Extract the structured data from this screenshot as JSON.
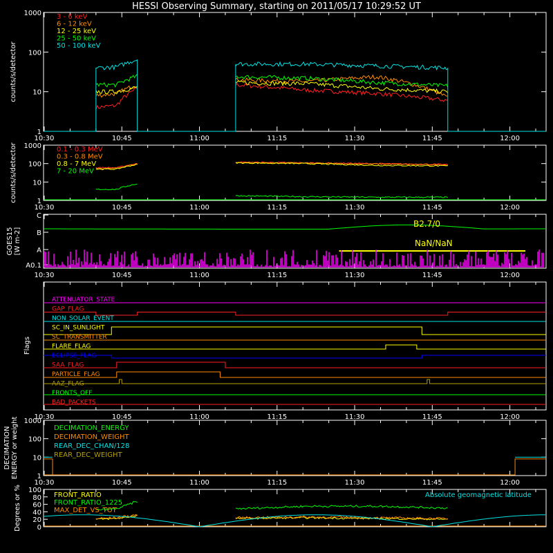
{
  "title": "HESSI Observing Summary, starting on 2011/05/17 10:29:52 UT",
  "time_ticks": [
    "10:30",
    "10:45",
    "11:00",
    "11:15",
    "11:30",
    "11:45",
    "12:00"
  ],
  "colors": {
    "red": "#ff2020",
    "orange": "#ff8c00",
    "yellow": "#ffff00",
    "green": "#00ff00",
    "cyan": "#00e5e5",
    "magenta": "#ff00ff",
    "blue": "#0000ff",
    "olive": "#b8a000",
    "axis": "#ffffff"
  },
  "panels": {
    "p1": {
      "ylabel": "counts/s/detector",
      "yticks": [
        "1",
        "10",
        "100",
        "1000"
      ],
      "legend": [
        "3 - 6 keV",
        "6 - 12 keV",
        "12 - 25 keV",
        "25 - 50 keV",
        "50 - 100 keV"
      ]
    },
    "p2": {
      "ylabel": "counts/s/detector",
      "yticks": [
        "1",
        "10",
        "100",
        "1000"
      ],
      "legend": [
        "0.1 - 0.3 MeV",
        "0.3 - 0.8 MeV",
        "0.8 - 7 MeV",
        "7 - 20 MeV"
      ]
    },
    "p3": {
      "ylabel": "GOES15",
      "ylabel_unit": "[W m-2]",
      "yticks": [
        "A0.1",
        "A",
        "B",
        "C"
      ],
      "annotations": [
        "B2.7/0",
        "NaN/NaN"
      ]
    },
    "p4": {
      "ylabel": "Flags",
      "flags": [
        "ATTENUATOR_STATE",
        "GAP_FLAG",
        "NON_SOLAR_EVENT",
        "SC_IN_SUNLIGHT",
        "SC_TRANSMITTER",
        "FLARE_FLAG",
        "ECLIPSE_FLAG",
        "SAA_FLAG",
        "PARTICLE_FLAG",
        "AAZ_FLAG",
        "FRONTS_OFF",
        "BAD_PACKETS"
      ]
    },
    "p5": {
      "ylabel_line1": "DECIMATION",
      "ylabel_line2": "ENERGY or weight",
      "yticks": [
        "1",
        "10",
        "100",
        "1000"
      ],
      "legend": [
        "DECIMATION_ENERGY",
        "DECIMATION_WEIGHT",
        "REAR_DEC_CHAN/128",
        "REAR_DEC_WEIGHT"
      ]
    },
    "p6": {
      "ylabel": "Degrees or %",
      "yticks": [
        "0",
        "20",
        "40",
        "60",
        "80",
        "100"
      ],
      "legend": [
        "FRONT_RATIO",
        "FRONT_RATIO_1225",
        "MAX_DET_VS_TOT"
      ],
      "right_legend": "Absolute geomagnetic latitude"
    }
  },
  "chart_data": {
    "type": "line",
    "title": "HESSI Observing Summary, starting on 2011/05/17 10:29:52 UT",
    "x_unit": "UT time",
    "x_range": [
      "10:30",
      "12:05"
    ],
    "data_intervals": [
      [
        "10:40",
        "10:48"
      ],
      [
        "11:07",
        "11:48"
      ]
    ],
    "energy_bands_keV": [
      {
        "name": "3 - 6 keV",
        "color": "#ff2020",
        "seg1": [
          4,
          4.5,
          12
        ],
        "seg2": [
          15,
          11,
          9,
          6
        ]
      },
      {
        "name": "6 - 12 keV",
        "color": "#ff8c00",
        "seg1": [
          8,
          9,
          15
        ],
        "seg2": [
          20,
          18,
          24,
          7
        ]
      },
      {
        "name": "12 - 25 keV",
        "color": "#ffff00",
        "seg1": [
          10,
          10,
          13
        ],
        "seg2": [
          17,
          16,
          12,
          10
        ]
      },
      {
        "name": "25 - 50 keV",
        "color": "#00ff00",
        "seg1": [
          15,
          15,
          25
        ],
        "seg2": [
          24,
          22,
          17,
          14
        ]
      },
      {
        "name": "50 - 100 keV",
        "color": "#00e5e5",
        "seg1": [
          40,
          42,
          65
        ],
        "seg2": [
          50,
          50,
          45,
          40
        ]
      }
    ],
    "goes15_class_levels": {
      "long": "B2.7",
      "marks": [
        "A0.1",
        "A",
        "B",
        "C"
      ]
    },
    "decimation_energy": {
      "right_value": 8
    },
    "front_ratio_percent": {
      "seg1": [
        45,
        50,
        70
      ],
      "seg2": [
        50,
        55,
        55,
        50
      ]
    },
    "geomagnetic_latitude_deg_minima": [
      "11:00",
      "11:45"
    ]
  }
}
